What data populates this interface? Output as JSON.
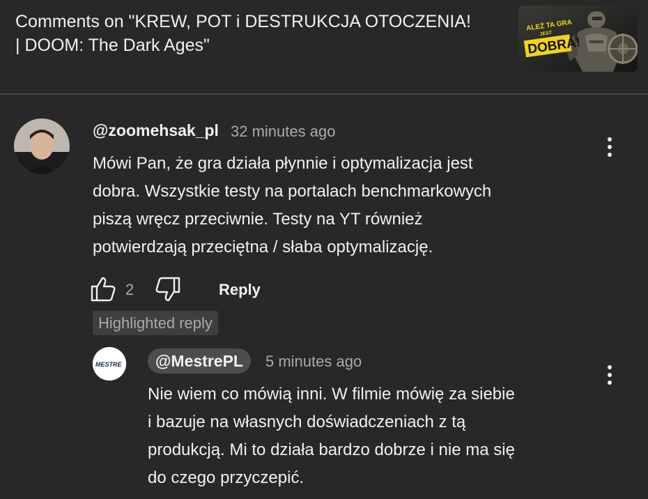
{
  "video": {
    "title_line1": "Comments on \"KREW, POT i DESTRUKCJA OTOCZENIA!",
    "title_line2": "| DOOM: The Dark Ages\"",
    "thumbnail": {
      "badge_top": "ALEŻ TA GRA",
      "badge_mid": "JEST",
      "badge_main": "DOBRA!"
    }
  },
  "comment": {
    "author": "@zoomehsak_pl",
    "time": "32 minutes ago",
    "lines": [
      "Mówi Pan, że gra działa płynnie i optymalizacja jest",
      "dobra. Wszystkie testy na portalach benchmarkowych",
      "piszą wręcz przeciwnie. Testy na YT również",
      "potwierdzają przeciętna / słaba optymalizację."
    ],
    "like_count": "2",
    "reply_label": "Reply",
    "menu_icon": "kebab-menu-icon",
    "like_icon": "thumb-up-icon",
    "dislike_icon": "thumb-down-icon"
  },
  "badge": {
    "label": "Highlighted reply"
  },
  "reply": {
    "author": "@MestrePL",
    "time": "5 minutes ago",
    "avatar_text": "MESTRE",
    "lines": [
      "Nie wiem co mówią inni. W filmie mówię za siebie",
      "i bazuje na własnych doświadczeniach z tą",
      "produkcją. Mi to działa bardzo dobrze i nie ma się",
      "do czego przyczepić."
    ],
    "menu_icon": "kebab-menu-icon"
  },
  "colors": {
    "background": "#282828",
    "text": "#f1f1f1",
    "secondary_text": "#aaaaaa",
    "badge_bg": "#3f3f3f",
    "pill_bg": "#4d4d4d",
    "thumb_yellow": "#f2d21b"
  }
}
